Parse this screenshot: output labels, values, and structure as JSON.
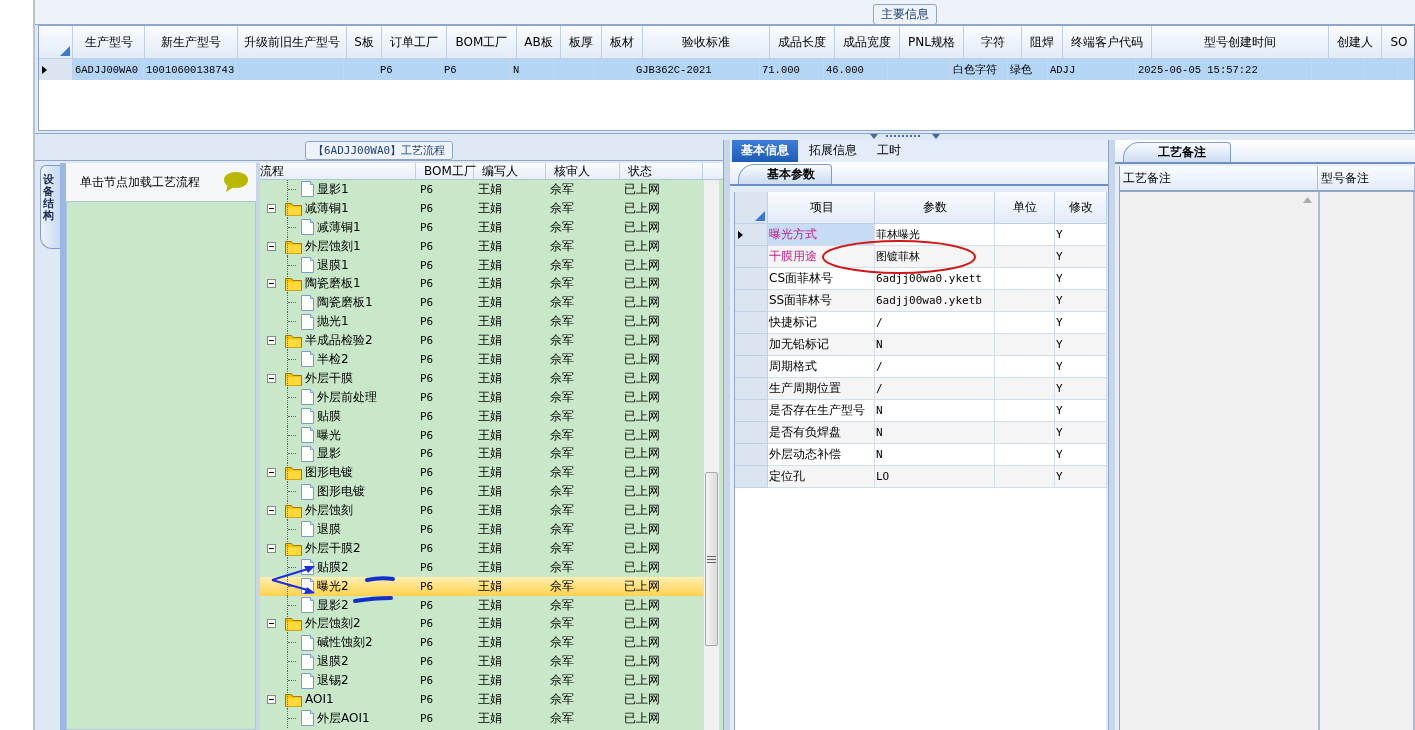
{
  "main_info": {
    "title": "主要信息",
    "row_selected": true,
    "columns": [
      {
        "label": "生产型号",
        "value": "6ADJJ00WA0"
      },
      {
        "label": "新生产型号",
        "value": "10010600138743"
      },
      {
        "label": "升级前旧生产型号"
      },
      {
        "label": "S板"
      },
      {
        "label": "订单工厂",
        "value": "P6"
      },
      {
        "label": "BOM工厂",
        "value": "P6"
      },
      {
        "label": "AB板",
        "value": "N"
      },
      {
        "label": "板厚"
      },
      {
        "label": "板材"
      },
      {
        "label": "验收标准",
        "value": "GJB362C-2021"
      },
      {
        "label": "成品长度",
        "value": "71.000"
      },
      {
        "label": "成品宽度",
        "value": "46.000"
      },
      {
        "label": "PNL规格"
      },
      {
        "label": "字符",
        "value": "白色字符"
      },
      {
        "label": "阻焊",
        "value": "绿色"
      },
      {
        "label": "终端客户代码",
        "value": "ADJJ"
      },
      {
        "label": "型号创建时间",
        "value": "2025-06-05 15:57:22"
      },
      {
        "label": "创建人"
      },
      {
        "label": "SO"
      }
    ]
  },
  "process": {
    "title": "【6ADJJ00WA0】工艺流程",
    "side_tab": "设备结构",
    "hint": "单击节点加载工艺流程",
    "columns": [
      "流程",
      "BOM工厂",
      "编写人",
      "核审人",
      "状态"
    ],
    "continued_children": [
      {
        "label": "显影1",
        "plant": "P6",
        "writer": "王娟",
        "reviewer": "佘军",
        "status": "已上网",
        "selected": false
      }
    ],
    "items": [
      {
        "label": "减薄铜1",
        "plant": "P6",
        "writer": "王娟",
        "reviewer": "佘军",
        "status": "已上网",
        "selected": false,
        "expanded": true,
        "children": [
          {
            "label": "减薄铜1",
            "plant": "P6",
            "writer": "王娟",
            "reviewer": "佘军",
            "status": "已上网",
            "selected": false
          }
        ]
      },
      {
        "label": "外层蚀刻1",
        "plant": "P6",
        "writer": "王娟",
        "reviewer": "佘军",
        "status": "已上网",
        "selected": false,
        "expanded": true,
        "children": [
          {
            "label": "退膜1",
            "plant": "P6",
            "writer": "王娟",
            "reviewer": "佘军",
            "status": "已上网",
            "selected": false
          }
        ]
      },
      {
        "label": "陶瓷磨板1",
        "plant": "P6",
        "writer": "王娟",
        "reviewer": "佘军",
        "status": "已上网",
        "selected": false,
        "expanded": true,
        "children": [
          {
            "label": "陶瓷磨板1",
            "plant": "P6",
            "writer": "王娟",
            "reviewer": "佘军",
            "status": "已上网",
            "selected": false
          },
          {
            "label": "抛光1",
            "plant": "P6",
            "writer": "王娟",
            "reviewer": "佘军",
            "status": "已上网",
            "selected": false
          }
        ]
      },
      {
        "label": "半成品检验2",
        "plant": "P6",
        "writer": "王娟",
        "reviewer": "佘军",
        "status": "已上网",
        "selected": false,
        "expanded": true,
        "children": [
          {
            "label": "半检2",
            "plant": "P6",
            "writer": "王娟",
            "reviewer": "佘军",
            "status": "已上网",
            "selected": false
          }
        ]
      },
      {
        "label": "外层干膜",
        "plant": "P6",
        "writer": "王娟",
        "reviewer": "佘军",
        "status": "已上网",
        "selected": false,
        "expanded": true,
        "children": [
          {
            "label": "外层前处理",
            "plant": "P6",
            "writer": "王娟",
            "reviewer": "佘军",
            "status": "已上网",
            "selected": false
          },
          {
            "label": "贴膜",
            "plant": "P6",
            "writer": "王娟",
            "reviewer": "佘军",
            "status": "已上网",
            "selected": false
          },
          {
            "label": "曝光",
            "plant": "P6",
            "writer": "王娟",
            "reviewer": "佘军",
            "status": "已上网",
            "selected": false
          },
          {
            "label": "显影",
            "plant": "P6",
            "writer": "王娟",
            "reviewer": "佘军",
            "status": "已上网",
            "selected": false
          }
        ]
      },
      {
        "label": "图形电镀",
        "plant": "P6",
        "writer": "王娟",
        "reviewer": "佘军",
        "status": "已上网",
        "selected": false,
        "expanded": true,
        "children": [
          {
            "label": "图形电镀",
            "plant": "P6",
            "writer": "王娟",
            "reviewer": "佘军",
            "status": "已上网",
            "selected": false
          }
        ]
      },
      {
        "label": "外层蚀刻",
        "plant": "P6",
        "writer": "王娟",
        "reviewer": "佘军",
        "status": "已上网",
        "selected": false,
        "expanded": true,
        "children": [
          {
            "label": "退膜",
            "plant": "P6",
            "writer": "王娟",
            "reviewer": "佘军",
            "status": "已上网",
            "selected": false
          }
        ]
      },
      {
        "label": "外层干膜2",
        "plant": "P6",
        "writer": "王娟",
        "reviewer": "佘军",
        "status": "已上网",
        "selected": false,
        "expanded": true,
        "children": [
          {
            "label": "贴膜2",
            "plant": "P6",
            "writer": "王娟",
            "reviewer": "佘军",
            "status": "已上网",
            "selected": false
          },
          {
            "label": "曝光2",
            "plant": "P6",
            "writer": "王娟",
            "reviewer": "佘军",
            "status": "已上网",
            "selected": true
          },
          {
            "label": "显影2",
            "plant": "P6",
            "writer": "王娟",
            "reviewer": "佘军",
            "status": "已上网",
            "selected": false
          }
        ]
      },
      {
        "label": "外层蚀刻2",
        "plant": "P6",
        "writer": "王娟",
        "reviewer": "佘军",
        "status": "已上网",
        "selected": false,
        "expanded": true,
        "children": [
          {
            "label": "碱性蚀刻2",
            "plant": "P6",
            "writer": "王娟",
            "reviewer": "佘军",
            "status": "已上网",
            "selected": false
          },
          {
            "label": "退膜2",
            "plant": "P6",
            "writer": "王娟",
            "reviewer": "佘军",
            "status": "已上网",
            "selected": false
          },
          {
            "label": "退锡2",
            "plant": "P6",
            "writer": "王娟",
            "reviewer": "佘军",
            "status": "已上网",
            "selected": false
          }
        ]
      },
      {
        "label": "AOI1",
        "plant": "P6",
        "writer": "王娟",
        "reviewer": "佘军",
        "status": "已上网",
        "selected": false,
        "expanded": true,
        "children": [
          {
            "label": "外层AOI1",
            "plant": "P6",
            "writer": "王娟",
            "reviewer": "佘军",
            "status": "已上网",
            "selected": false
          }
        ]
      }
    ]
  },
  "detail": {
    "tabs": [
      {
        "label": "基本信息",
        "selected": true
      },
      {
        "label": "拓展信息",
        "selected": false
      },
      {
        "label": "工时",
        "selected": false
      }
    ],
    "subtab": "基本参数",
    "columns": [
      "项目",
      "参数",
      "单位",
      "修改"
    ],
    "rows": [
      {
        "item": "曝光方式",
        "value": "菲林曝光",
        "modify": "Y",
        "highlighted": true,
        "selected": true
      },
      {
        "item": "干膜用途",
        "value": "图镀菲林",
        "modify": "Y",
        "highlighted": true,
        "selected": false
      },
      {
        "item": "CS面菲林号",
        "value": "6adjj00wa0.ykett",
        "modify": "Y",
        "highlighted": false,
        "selected": false
      },
      {
        "item": "SS面菲林号",
        "value": "6adjj00wa0.yketb",
        "modify": "Y",
        "highlighted": false,
        "selected": false
      },
      {
        "item": "快捷标记",
        "value": "/",
        "modify": "Y",
        "highlighted": false,
        "selected": false
      },
      {
        "item": "加无铅标记",
        "value": "N",
        "modify": "Y",
        "highlighted": false,
        "selected": false
      },
      {
        "item": "周期格式",
        "value": "/",
        "modify": "Y",
        "highlighted": false,
        "selected": false
      },
      {
        "item": "生产周期位置",
        "value": "/",
        "modify": "Y",
        "highlighted": false,
        "selected": false
      },
      {
        "item": "是否存在生产型号",
        "value": "N",
        "modify": "Y",
        "highlighted": false,
        "selected": false
      },
      {
        "item": "是否有负焊盘",
        "value": "N",
        "modify": "Y",
        "highlighted": false,
        "selected": false
      },
      {
        "item": "外层动态补偿",
        "value": "N",
        "modify": "Y",
        "highlighted": false,
        "selected": false
      },
      {
        "item": "定位孔",
        "value": "LO",
        "modify": "Y",
        "highlighted": false,
        "selected": false
      }
    ]
  },
  "notes": {
    "tab": "工艺备注",
    "columns": [
      "工艺备注",
      "型号备注"
    ]
  }
}
